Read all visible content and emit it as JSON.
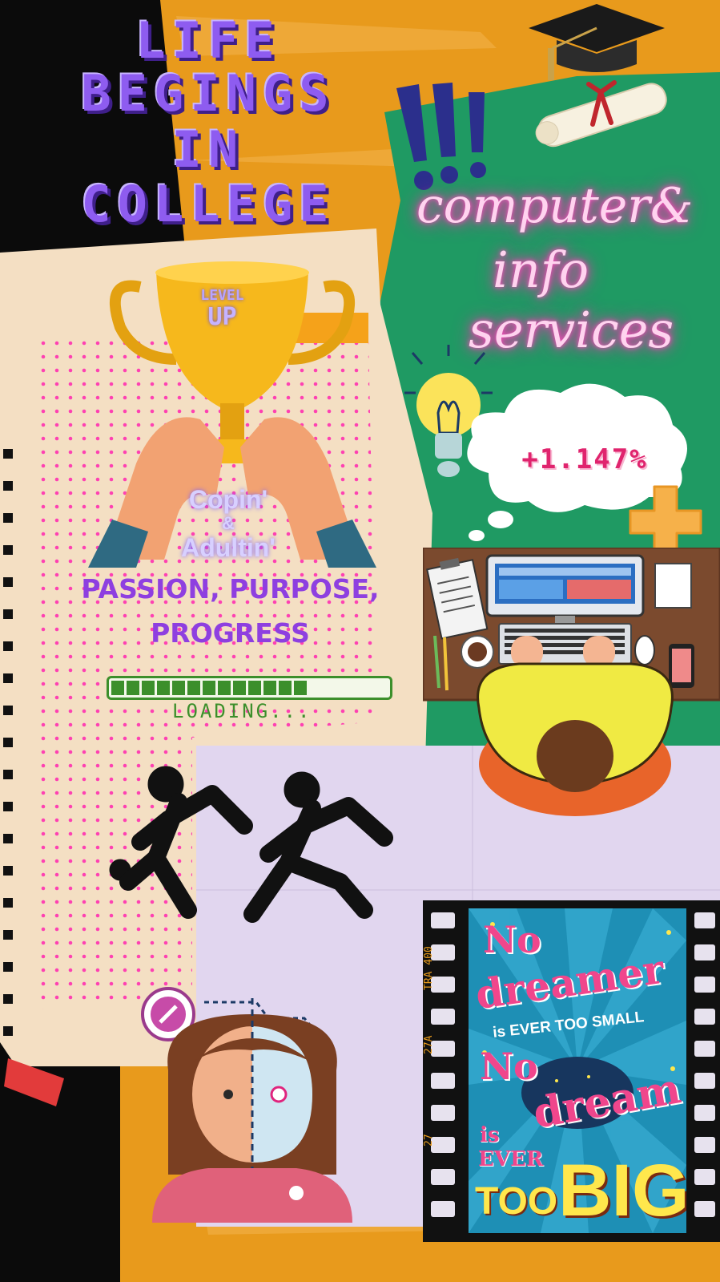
{
  "title": {
    "line1": "LIFE",
    "line2": "BEGINGS",
    "line3": "IN",
    "line4": "COLLEGE"
  },
  "neon_text": {
    "line1": "computer&",
    "line2": "info",
    "line3": "services"
  },
  "trophy": {
    "level": "LEVEL",
    "up": "UP"
  },
  "coping": {
    "line1": "Copin'",
    "line2": "&",
    "line3": "Adultin'"
  },
  "tagline": {
    "line1": "PASSION, PURPOSE,",
    "line2": "PROGRESS"
  },
  "progress": {
    "fill_fraction": 0.71,
    "label": "LOADING..."
  },
  "thought_bubble": {
    "value": "+1.147%"
  },
  "film": {
    "top_code": "TRA 400",
    "code_mid1": "27A",
    "code_mid2": "27"
  },
  "poster": {
    "l1": "No",
    "l2": "dreamer",
    "l3": "is EVER TOO SMALL",
    "l4": "No",
    "l5": "dream",
    "l6": "is",
    "l7": "EVER",
    "l8": "TOO",
    "l9": "BIG"
  },
  "colors": {
    "purple": "#8e5cf0",
    "green_board": "#1f9a63",
    "orange_wall": "#e89a1c",
    "paper": "#f4dfc3",
    "lavender": "#e1d6ef",
    "neon_pink": "#ff4fc0"
  },
  "icons": [
    "graduation-cap-icon",
    "diploma-icon",
    "exclamation-icon",
    "trophy-icon",
    "lightbulb-icon",
    "thought-cloud-icon",
    "plus-icon",
    "desk-computer-icon",
    "running-people-icon",
    "robot-woman-icon",
    "film-strip-icon"
  ]
}
